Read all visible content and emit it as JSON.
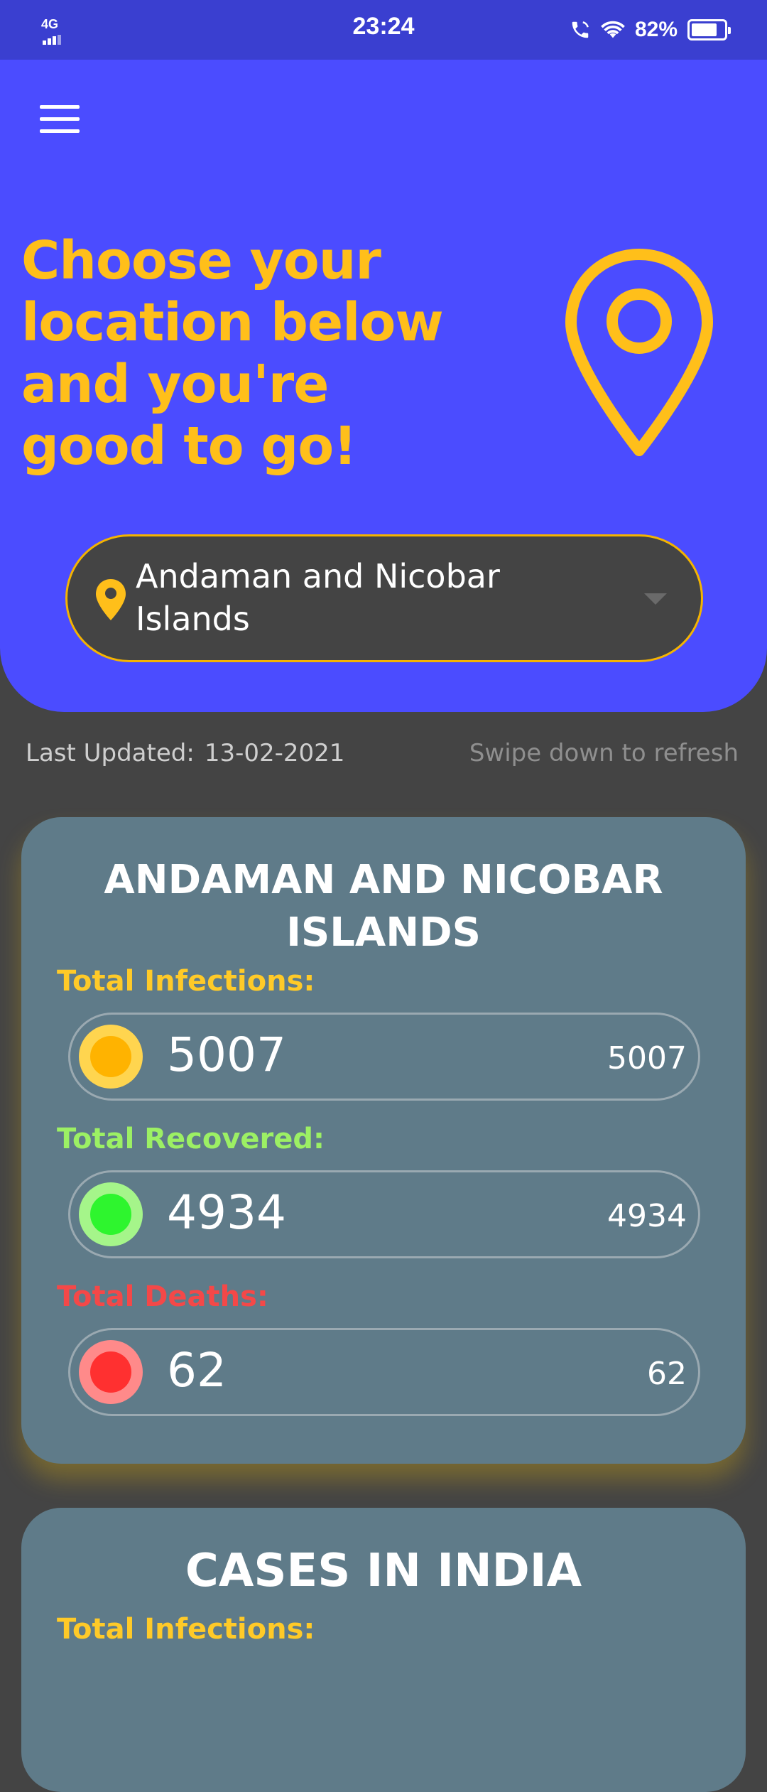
{
  "status_bar": {
    "network": "4G",
    "time": "23:24",
    "battery": "82%"
  },
  "header": {
    "headline_lines": [
      "Choose your",
      "location below",
      "and you're",
      "good to go!"
    ],
    "selected_location": "Andaman and Nicobar Islands",
    "accent_color": "#ffbf1a",
    "background_color": "#4b4cff"
  },
  "update_info": {
    "label": "Last Updated:",
    "date": "13-02-2021",
    "refresh_hint": "Swipe down to refresh"
  },
  "state_card": {
    "title": "ANDAMAN AND NICOBAR ISLANDS",
    "infections": {
      "label": "Total Infections:",
      "value": "5007",
      "value_small": "5007"
    },
    "recovered": {
      "label": "Total Recovered:",
      "value": "4934",
      "value_small": "4934"
    },
    "deaths": {
      "label": "Total Deaths:",
      "value": "62",
      "value_small": "62"
    }
  },
  "india_card": {
    "title": "CASES IN INDIA",
    "infections_label": "Total Infections:"
  }
}
